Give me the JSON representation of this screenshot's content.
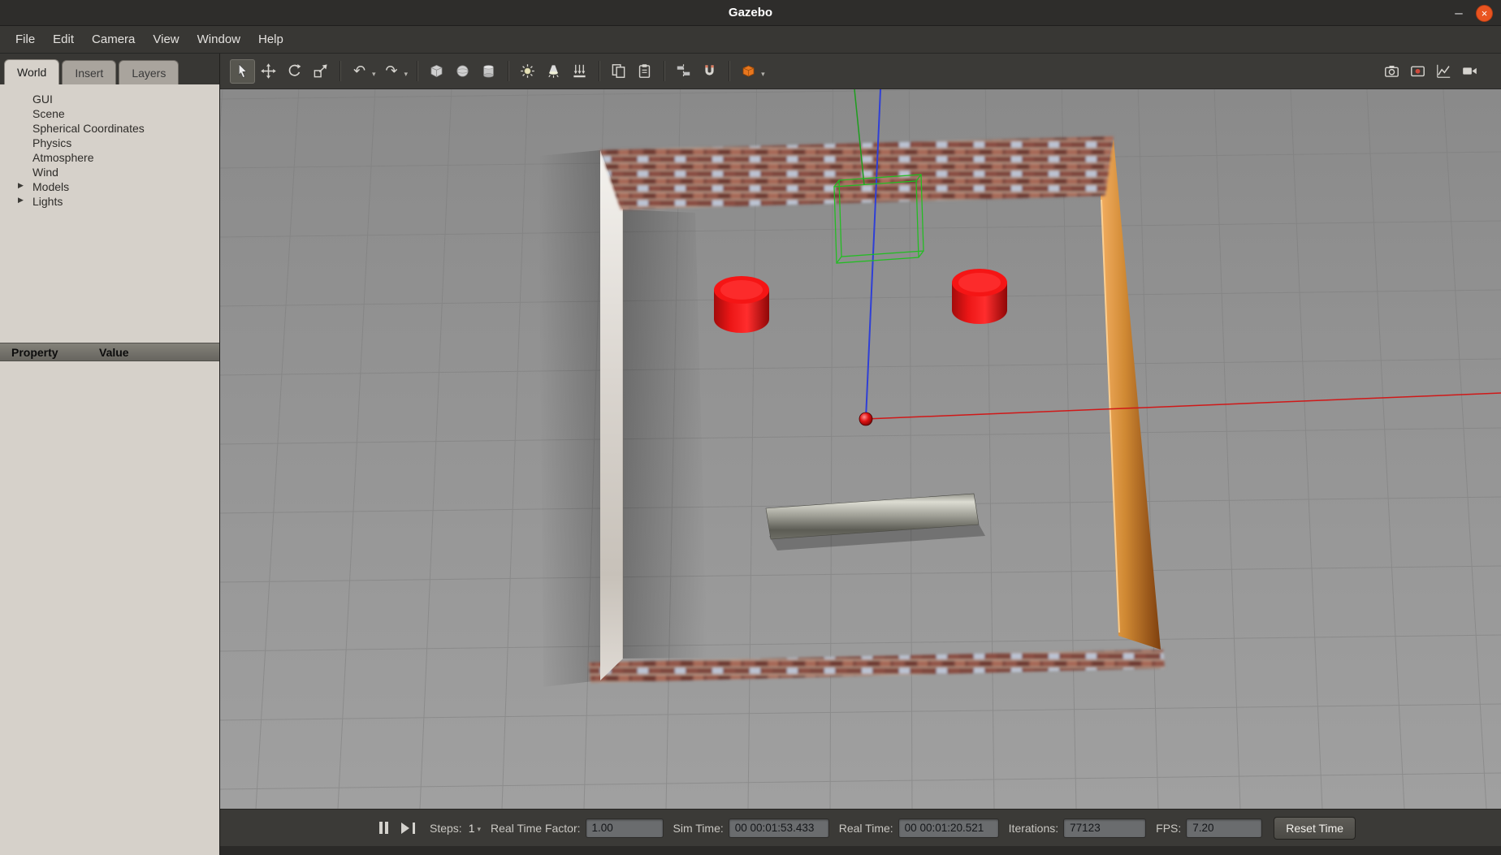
{
  "titlebar": {
    "title": "Gazebo"
  },
  "menubar": {
    "items": [
      "File",
      "Edit",
      "Camera",
      "View",
      "Window",
      "Help"
    ]
  },
  "sidebar": {
    "tabs": [
      {
        "label": "World",
        "active": true
      },
      {
        "label": "Insert",
        "active": false
      },
      {
        "label": "Layers",
        "active": false
      }
    ],
    "tree_items": [
      "GUI",
      "Scene",
      "Spherical Coordinates",
      "Physics",
      "Atmosphere",
      "Wind",
      "Models",
      "Lights"
    ],
    "property_table": {
      "property_header": "Property",
      "value_header": "Value"
    }
  },
  "toolbar": {
    "tools": [
      "select",
      "translate",
      "rotate",
      "scale",
      "undo",
      "redo",
      "box",
      "sphere",
      "cylinder",
      "point-light",
      "spot-light",
      "directional-light",
      "copy",
      "paste",
      "align",
      "snap",
      "insert-model"
    ],
    "right_tools": [
      "screenshot",
      "data-logger",
      "plot",
      "video-record"
    ]
  },
  "statusbar": {
    "steps_label": "Steps:",
    "steps_value": "1",
    "rtf_label": "Real Time Factor:",
    "rtf_value": "1.00",
    "sim_time_label": "Sim Time:",
    "sim_time_value": "00 00:01:53.433",
    "real_time_label": "Real Time:",
    "real_time_value": "00 00:01:20.521",
    "iterations_label": "Iterations:",
    "iterations_value": "77123",
    "fps_label": "FPS:",
    "fps_value": "7.20",
    "reset_button": "Reset Time"
  },
  "icons": {
    "minimize": "–",
    "close": "×",
    "expand_arrow": "▶",
    "dropdown_caret": "▾",
    "undo": "↶",
    "redo": "↷"
  },
  "scene": {
    "colors": {
      "background": "#939393",
      "grid": "#7b7b7b",
      "x_axis": "#d01818",
      "y_axis": "#1d9e1d",
      "z_axis": "#2f3fd6",
      "selection_box": "#1fbf1f",
      "cylinder_red": "#e81414",
      "wall_brick": "#8a5148",
      "wall_white": "#d8d3ce",
      "wall_wood": "#d18a34",
      "beam_gray": "#9a9a92",
      "origin_marker": "#d40000",
      "close_button": "#E95420"
    }
  }
}
